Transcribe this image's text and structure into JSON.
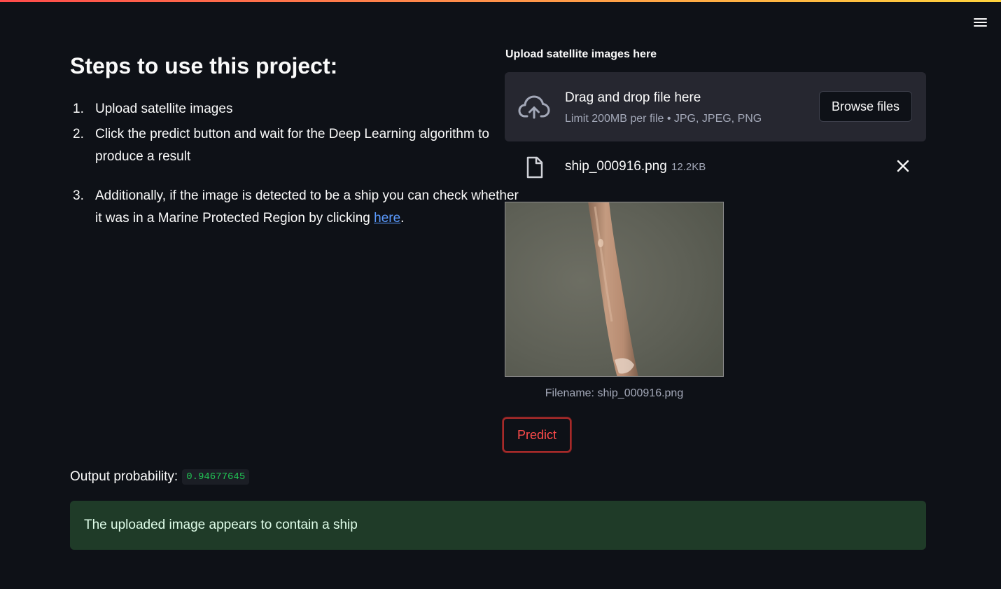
{
  "header": {
    "menu_icon": "hamburger-menu-icon"
  },
  "instructions": {
    "heading": "Steps to use this project:",
    "steps": [
      {
        "num": "1.",
        "text": "Upload satellite images"
      },
      {
        "num": "2.",
        "text": "Click the predict button and wait for the Deep Learning algorithm to produce a result"
      },
      {
        "num": "3.",
        "text_before": "Additionally, if the image is detected to be a ship you can check whether it was in a Marine Protected Region by clicking ",
        "link_text": "here",
        "text_after": "."
      }
    ]
  },
  "uploader": {
    "label": "Upload satellite images here",
    "drag_text": "Drag and drop file here",
    "limit_text": "Limit 200MB per file • JPG, JPEG, PNG",
    "browse_label": "Browse files",
    "upload_icon": "cloud-upload-icon"
  },
  "uploaded_file": {
    "name": "ship_000916.png",
    "size": "12.2KB",
    "file_icon": "file-icon",
    "remove_icon": "close-icon"
  },
  "preview": {
    "caption": "Filename: ship_000916.png"
  },
  "actions": {
    "predict_label": "Predict"
  },
  "output": {
    "label": "Output probability:",
    "value": "0.94677645"
  },
  "result": {
    "message": "The uploaded image appears to contain a ship"
  },
  "colors": {
    "background": "#0e1117",
    "panel": "#262730",
    "accent_red": "#ff4b4b",
    "link_blue": "#5b9bff",
    "success_bg": "#1f3b28",
    "code_green": "#21c354"
  }
}
